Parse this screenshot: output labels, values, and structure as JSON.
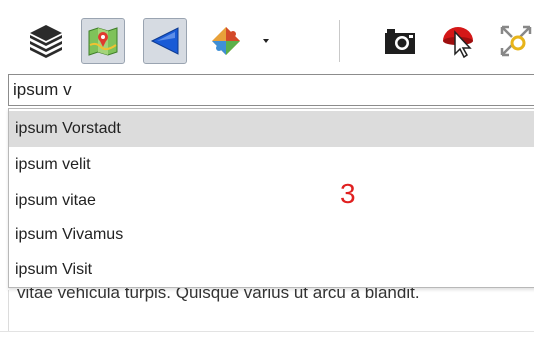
{
  "toolbar": {
    "buttons": [
      {
        "name": "layers-icon",
        "pressed": false
      },
      {
        "name": "map-icon",
        "pressed": true
      },
      {
        "name": "back-arrow-icon",
        "pressed": true
      },
      {
        "name": "puzzle-icon",
        "pressed": false
      },
      {
        "name": "camera-icon",
        "pressed": false
      },
      {
        "name": "pointer-icon",
        "pressed": false
      },
      {
        "name": "zoom-extent-icon",
        "pressed": false
      }
    ]
  },
  "search": {
    "value": "ipsum v"
  },
  "dropdown": {
    "items": [
      {
        "label": "ipsum Vorstadt",
        "selected": true
      },
      {
        "label": "ipsum velit",
        "selected": false
      },
      {
        "label": "ipsum vitae",
        "selected": false
      },
      {
        "label": "ipsum Vivamus",
        "selected": false
      },
      {
        "label": "ipsum Visit",
        "selected": false
      }
    ]
  },
  "annotation": "3",
  "background_text": "vitae vehicula turpis. Quisque varius ut arcu a blandit.",
  "colors": {
    "pressed_bg": "#d6dbe2",
    "selected_item": "#dcdcdc",
    "annotation": "#e02020",
    "arrow_blue": "#1a5bd6"
  }
}
